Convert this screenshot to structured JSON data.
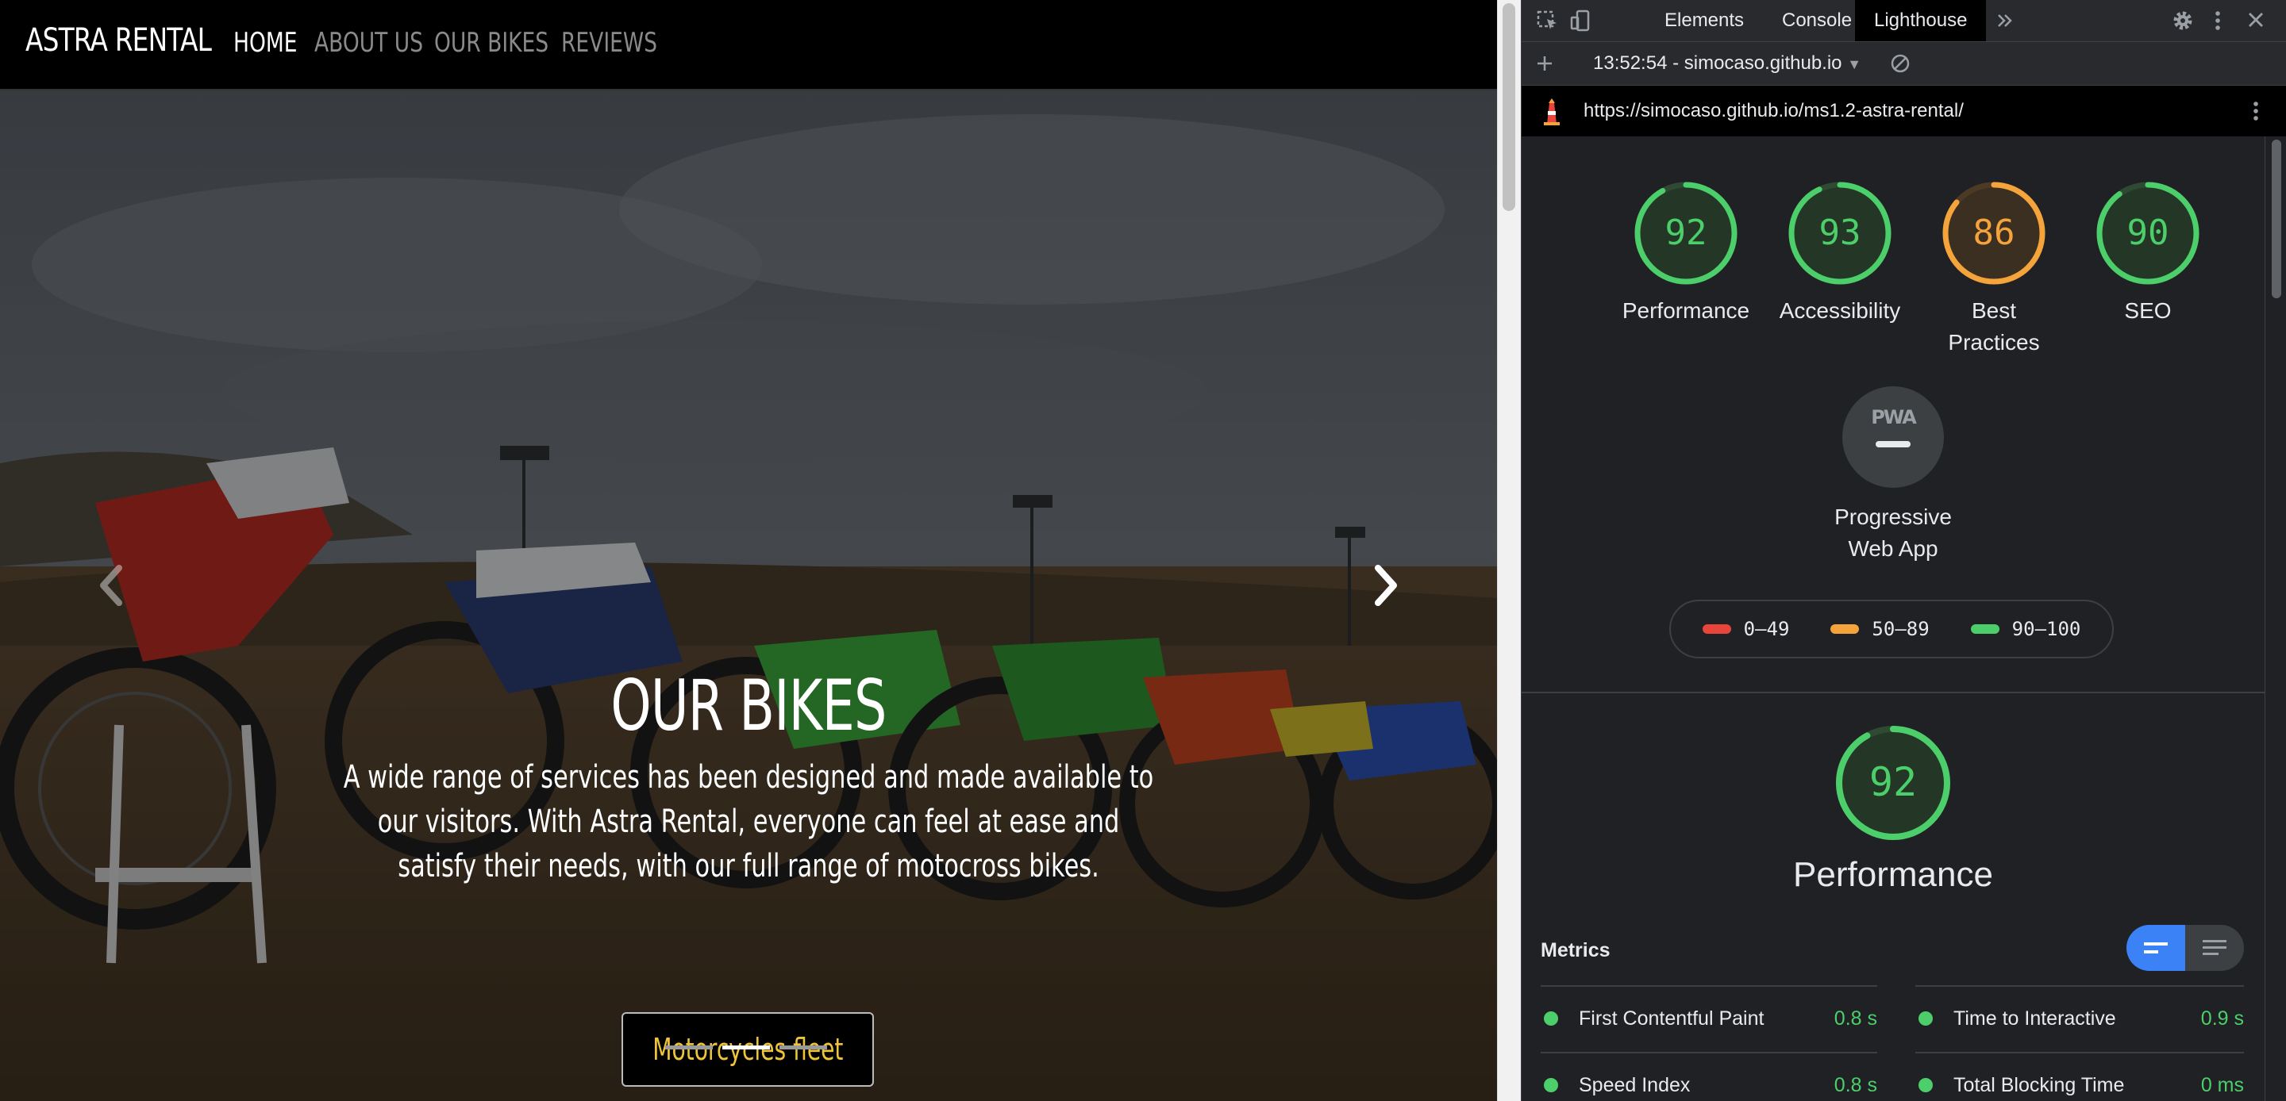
{
  "site": {
    "brand": "ASTRA RENTAL",
    "nav": [
      "HOME",
      "ABOUT US",
      "OUR BIKES",
      "REVIEWS"
    ],
    "active_nav": "HOME",
    "hero": {
      "title": "OUR BIKES",
      "text": "A wide range of services has been designed and made available to our visitors. With Astra Rental, everyone can feel at ease and satisfy their needs, with our full range of motocross bikes.",
      "button": "Motorcycles fleet",
      "active_slide": 2,
      "slide_count": 3
    }
  },
  "devtools": {
    "tabs": [
      "Elements",
      "Console",
      "Lighthouse"
    ],
    "active_tab": "Lighthouse",
    "more_tabs_icon": "chevron-double-right-icon",
    "report_select": "13:52:54 - simocaso.github.io",
    "url": "https://simocaso.github.io/ms1.2-astra-rental/"
  },
  "lighthouse": {
    "scores": [
      {
        "label": "Performance",
        "value": 92,
        "color": "#4ccf6a"
      },
      {
        "label": "Accessibility",
        "value": 93,
        "color": "#4ccf6a"
      },
      {
        "label": "Best Practices",
        "value": 86,
        "color": "#f5a33b"
      },
      {
        "label": "SEO",
        "value": 90,
        "color": "#4ccf6a"
      }
    ],
    "pwa": {
      "badge": "PWA",
      "label": "Progressive Web App"
    },
    "legend": [
      {
        "range": "0–49",
        "color": "#e8453c"
      },
      {
        "range": "50–89",
        "color": "#f5a33b"
      },
      {
        "range": "90–100",
        "color": "#4ccf6a"
      }
    ],
    "performance": {
      "score": 92,
      "title": "Performance"
    },
    "metrics_label": "Metrics",
    "metrics": [
      {
        "name": "First Contentful Paint",
        "value": "0.8 s"
      },
      {
        "name": "Time to Interactive",
        "value": "0.9 s"
      },
      {
        "name": "Speed Index",
        "value": "0.8 s"
      },
      {
        "name": "Total Blocking Time",
        "value": "0 ms"
      }
    ]
  },
  "colors": {
    "pass": "#4ccf6a",
    "average": "#f5a33b",
    "fail": "#e8453c",
    "accent_blue": "#3b82f6",
    "button_text": "#f0c43a"
  }
}
